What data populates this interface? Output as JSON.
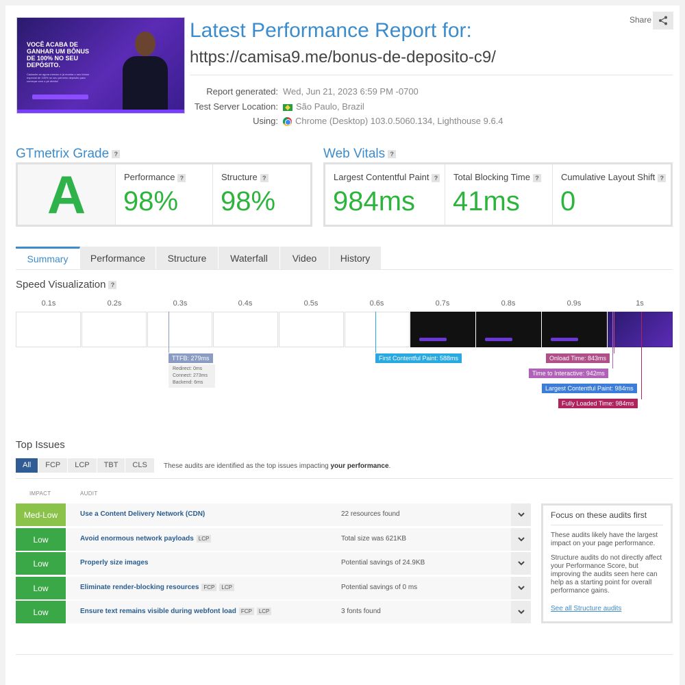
{
  "header": {
    "title": "Latest Performance Report for:",
    "url": "https://camisa9.me/bonus-de-deposito-c9/",
    "share_label": "Share",
    "thumbnail": {
      "headline": "VOCÊ ACABA DE GANHAR UM BÔNUS DE 100% NO SEU DEPÓSITO.",
      "body": "Cadastre-se agora mesmo e já receba o seu bônus especial de 100% no seu primeiro depósito para começar com o pé direito!"
    }
  },
  "meta": {
    "generated_label": "Report generated:",
    "generated_value": "Wed, Jun 21, 2023 6:59 PM -0700",
    "location_label": "Test Server Location:",
    "location_value": "São Paulo, Brazil",
    "using_label": "Using:",
    "using_value": "Chrome (Desktop) 103.0.5060.134, Lighthouse 9.6.4"
  },
  "grade": {
    "heading": "GTmetrix Grade",
    "letter": "A",
    "performance_label": "Performance",
    "performance_value": "98%",
    "structure_label": "Structure",
    "structure_value": "98%"
  },
  "vitals": {
    "heading": "Web Vitals",
    "lcp_label": "Largest Contentful Paint",
    "lcp_value": "984ms",
    "tbt_label": "Total Blocking Time",
    "tbt_value": "41ms",
    "cls_label": "Cumulative Layout Shift",
    "cls_value": "0"
  },
  "tabs": [
    "Summary",
    "Performance",
    "Structure",
    "Waterfall",
    "Video",
    "History"
  ],
  "speed": {
    "heading": "Speed Visualization",
    "ticks": [
      "0.1s",
      "0.2s",
      "0.3s",
      "0.4s",
      "0.5s",
      "0.6s",
      "0.7s",
      "0.8s",
      "0.9s",
      "1s"
    ],
    "ttfb": "TTFB: 279ms",
    "ttfb_redirect": "Redirect: 0ms",
    "ttfb_connect": "Connect: 273ms",
    "ttfb_backend": "Backend: 6ms",
    "fcp": "First Contentful Paint: 588ms",
    "onload": "Onload Time: 843ms",
    "tti": "Time to Interactive: 942ms",
    "lcp": "Largest Contentful Paint: 984ms",
    "fully": "Fully Loaded Time: 984ms"
  },
  "issues": {
    "heading": "Top Issues",
    "filters": [
      "All",
      "FCP",
      "LCP",
      "TBT",
      "CLS"
    ],
    "note_prefix": "These audits are identified as the top issues impacting ",
    "note_bold": "your performance",
    "note_suffix": ".",
    "col_impact": "IMPACT",
    "col_audit": "AUDIT",
    "rows": [
      {
        "impact": "Med-Low",
        "audit": "Use a Content Delivery Network (CDN)",
        "chips": [],
        "result": "22 resources found",
        "color": "#8bc34a"
      },
      {
        "impact": "Low",
        "audit": "Avoid enormous network payloads",
        "chips": [
          "LCP"
        ],
        "result": "Total size was 621KB",
        "color": "#3aa846"
      },
      {
        "impact": "Low",
        "audit": "Properly size images",
        "chips": [],
        "result": "Potential savings of 24.9KB",
        "color": "#3aa846"
      },
      {
        "impact": "Low",
        "audit": "Eliminate render-blocking resources",
        "chips": [
          "FCP",
          "LCP"
        ],
        "result": "Potential savings of 0 ms",
        "color": "#3aa846"
      },
      {
        "impact": "Low",
        "audit": "Ensure text remains visible during webfont load",
        "chips": [
          "FCP",
          "LCP"
        ],
        "result": "3 fonts found",
        "color": "#3aa846"
      }
    ]
  },
  "focus": {
    "title": "Focus on these audits first",
    "p1": "These audits likely have the largest impact on your page performance.",
    "p2": "Structure audits do not directly affect your Performance Score, but improving the audits seen here can help as a starting point for overall performance gains.",
    "link": "See all Structure audits"
  },
  "colors": {
    "accent": "#3c8ccc",
    "grade_green": "#2eb249",
    "ttfb": "#8a9cc4",
    "fcp": "#29a9e1",
    "onload": "#b04f88",
    "tti": "#b061b8",
    "lcp": "#3b7dd8",
    "fully": "#b0245e"
  }
}
